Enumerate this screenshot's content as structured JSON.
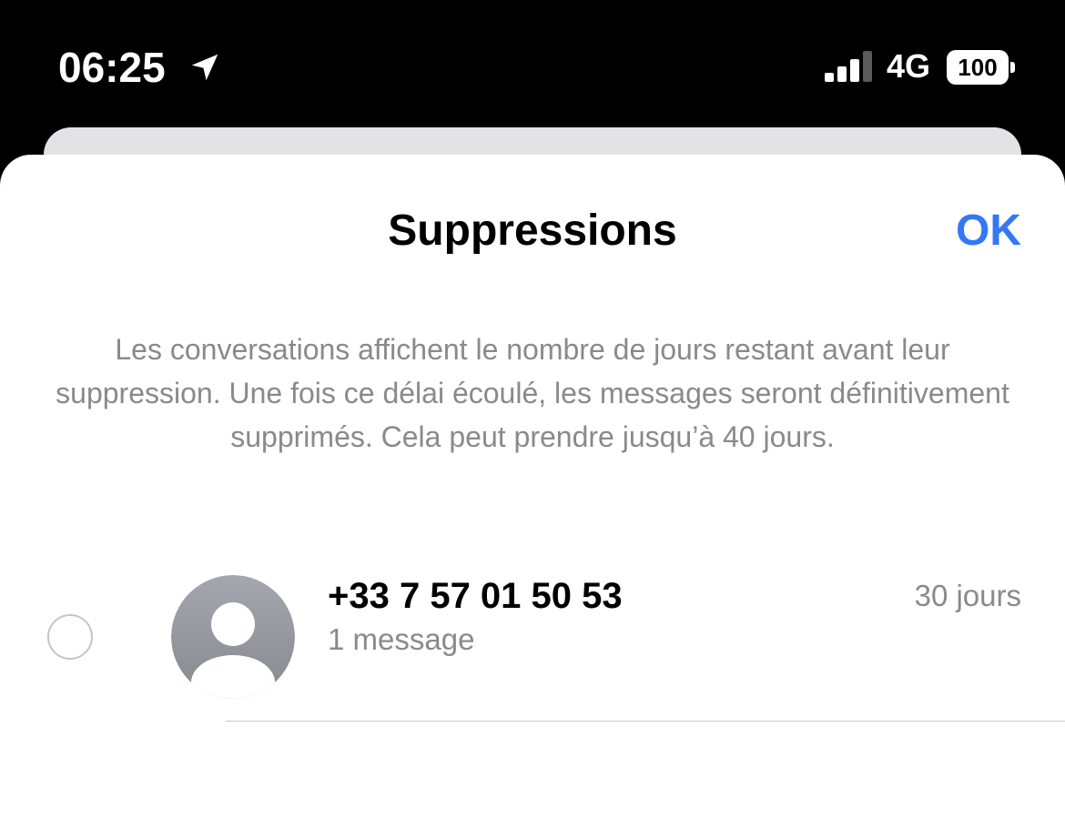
{
  "status_bar": {
    "time": "06:25",
    "network": "4G",
    "battery": "100",
    "location_icon": "location-arrow-icon",
    "signal_icon": "cellular-signal-icon",
    "signal_bars_active": 3,
    "signal_bars_total": 4
  },
  "sheet": {
    "title": "Suppressions",
    "ok_label": "OK",
    "info": "Les conversations affichent le nombre de jours restant avant leur suppression. Une fois ce délai écoulé, les messages seront définitivement supprimés. Cela peut prendre jusqu’à 40 jours."
  },
  "conversations": [
    {
      "name": "+33 7 57 01 50 53",
      "subtitle": "1 message",
      "days_left": "30 jours",
      "avatar_icon": "person-placeholder-icon",
      "selected": false
    }
  ],
  "colors": {
    "accent": "#3478f6",
    "secondary_text": "#8a8a8e",
    "background": "#ffffff",
    "status_bar": "#000000"
  }
}
